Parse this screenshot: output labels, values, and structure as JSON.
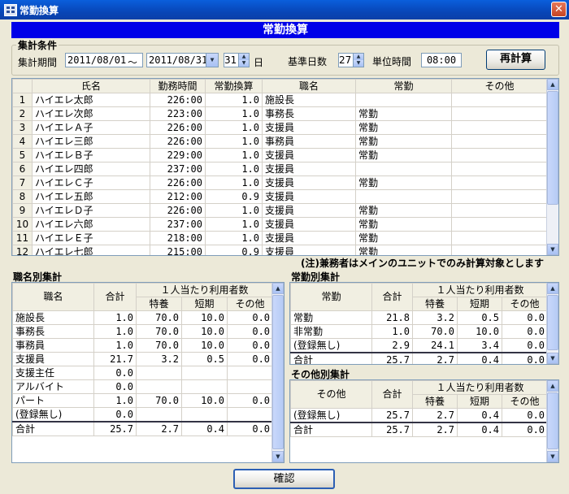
{
  "window": {
    "title": "常勤換算",
    "close_glyph": "✕"
  },
  "banner": "常勤換算",
  "conditions": {
    "legend": "集計条件",
    "period_label": "集計期間",
    "date_from": "2011/08/01",
    "tilde": "〜",
    "date_to": "2011/08/31",
    "days": "31",
    "days_unit": "日",
    "base_days_label": "基準日数",
    "base_days": "27",
    "unit_time_label": "単位時間",
    "unit_time": "08:00",
    "recalc_label": "再計算"
  },
  "main_table": {
    "headers": [
      "氏名",
      "勤務時間",
      "常勤換算",
      "職名",
      "常勤",
      "その他"
    ],
    "rows": [
      [
        "1",
        "ハイエレ太郎",
        "226:00",
        "1.0",
        "施設長",
        "",
        ""
      ],
      [
        "2",
        "ハイエレ次郎",
        "223:00",
        "1.0",
        "事務長",
        "常勤",
        ""
      ],
      [
        "3",
        "ハイエレＡ子",
        "226:00",
        "1.0",
        "支援員",
        "常勤",
        ""
      ],
      [
        "4",
        "ハイエレ三郎",
        "226:00",
        "1.0",
        "事務員",
        "常勤",
        ""
      ],
      [
        "5",
        "ハイエレＢ子",
        "229:00",
        "1.0",
        "支援員",
        "常勤",
        ""
      ],
      [
        "6",
        "ハイエレ四郎",
        "237:00",
        "1.0",
        "支援員",
        "",
        ""
      ],
      [
        "7",
        "ハイエレＣ子",
        "226:00",
        "1.0",
        "支援員",
        "常勤",
        ""
      ],
      [
        "8",
        "ハイエレ五郎",
        "212:00",
        "0.9",
        "支援員",
        "",
        ""
      ],
      [
        "9",
        "ハイエレＤ子",
        "226:00",
        "1.0",
        "支援員",
        "常勤",
        ""
      ],
      [
        "10",
        "ハイエレ六郎",
        "237:00",
        "1.0",
        "支援員",
        "常勤",
        ""
      ],
      [
        "11",
        "ハイエレＥ子",
        "218:00",
        "1.0",
        "支援員",
        "常勤",
        ""
      ],
      [
        "12",
        "ハイエレ七郎",
        "215:00",
        "0.9",
        "支援員",
        "常勤",
        ""
      ]
    ]
  },
  "note": "(注)兼務者はメインのユニットでのみ計算対象とします",
  "by_title": {
    "title": "職名別集計",
    "h_name": "職名",
    "h_total": "合計",
    "h_per": "１人当たり利用者数",
    "h_sub": [
      "特養",
      "短期",
      "その他"
    ],
    "rows": [
      [
        "施設長",
        "1.0",
        "70.0",
        "10.0",
        "0.0"
      ],
      [
        "事務長",
        "1.0",
        "70.0",
        "10.0",
        "0.0"
      ],
      [
        "事務員",
        "1.0",
        "70.0",
        "10.0",
        "0.0"
      ],
      [
        "支援員",
        "21.7",
        "3.2",
        "0.5",
        "0.0"
      ],
      [
        "支援主任",
        "0.0",
        "",
        "",
        ""
      ],
      [
        "アルバイト",
        "0.0",
        "",
        "",
        ""
      ],
      [
        "パート",
        "1.0",
        "70.0",
        "10.0",
        "0.0"
      ],
      [
        "(登録無し)",
        "0.0",
        "",
        "",
        ""
      ]
    ],
    "total": [
      "合計",
      "25.7",
      "2.7",
      "0.4",
      "0.0"
    ]
  },
  "by_fulltime": {
    "title": "常勤別集計",
    "h_name": "常勤",
    "h_total": "合計",
    "h_per": "１人当たり利用者数",
    "h_sub": [
      "特養",
      "短期",
      "その他"
    ],
    "rows": [
      [
        "常勤",
        "21.8",
        "3.2",
        "0.5",
        "0.0"
      ],
      [
        "非常勤",
        "1.0",
        "70.0",
        "10.0",
        "0.0"
      ],
      [
        "(登録無し)",
        "2.9",
        "24.1",
        "3.4",
        "0.0"
      ]
    ],
    "total": [
      "合計",
      "25.7",
      "2.7",
      "0.4",
      "0.0"
    ]
  },
  "by_other": {
    "title": "その他別集計",
    "h_name": "その他",
    "h_total": "合計",
    "h_per": "１人当たり利用者数",
    "h_sub": [
      "特養",
      "短期",
      "その他"
    ],
    "rows": [
      [
        "(登録無し)",
        "25.7",
        "2.7",
        "0.4",
        "0.0"
      ]
    ],
    "total": [
      "合計",
      "25.7",
      "2.7",
      "0.4",
      "0.0"
    ]
  },
  "confirm_label": "確認"
}
